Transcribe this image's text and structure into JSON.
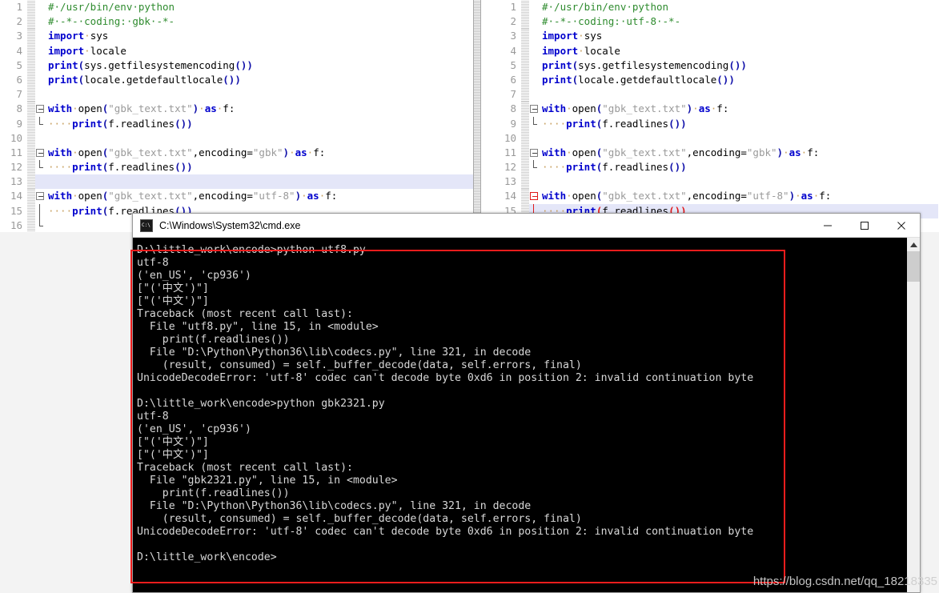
{
  "editor": {
    "left_pane": {
      "name": "gbk-source-editor",
      "lines": [
        {
          "no": "1",
          "tokens": [
            {
              "t": "comment",
              "v": "#·/usr/bin/env·python"
            }
          ]
        },
        {
          "no": "2",
          "tokens": [
            {
              "t": "comment",
              "v": "#·-*-·coding:·gbk·-*-"
            }
          ]
        },
        {
          "no": "3",
          "tokens": [
            {
              "t": "kw",
              "v": "import"
            },
            {
              "t": "ws",
              "v": "·"
            },
            {
              "t": "plain",
              "v": "sys"
            }
          ]
        },
        {
          "no": "4",
          "tokens": [
            {
              "t": "kw",
              "v": "import"
            },
            {
              "t": "ws",
              "v": "·"
            },
            {
              "t": "plain",
              "v": "locale"
            }
          ]
        },
        {
          "no": "5",
          "tokens": [
            {
              "t": "fn",
              "v": "print"
            },
            {
              "t": "paren",
              "v": "("
            },
            {
              "t": "plain",
              "v": "sys.getfilesystemencoding"
            },
            {
              "t": "paren",
              "v": "())"
            }
          ]
        },
        {
          "no": "6",
          "tokens": [
            {
              "t": "fn",
              "v": "print"
            },
            {
              "t": "paren",
              "v": "("
            },
            {
              "t": "plain",
              "v": "locale.getdefaultlocale"
            },
            {
              "t": "paren",
              "v": "())"
            }
          ]
        },
        {
          "no": "7",
          "tokens": []
        },
        {
          "no": "8",
          "fold": "open",
          "tokens": [
            {
              "t": "kw",
              "v": "with"
            },
            {
              "t": "ws",
              "v": "·"
            },
            {
              "t": "plain",
              "v": "open"
            },
            {
              "t": "paren",
              "v": "("
            },
            {
              "t": "str",
              "v": "\"gbk_text.txt\""
            },
            {
              "t": "paren",
              "v": ")"
            },
            {
              "t": "ws",
              "v": "·"
            },
            {
              "t": "kw",
              "v": "as"
            },
            {
              "t": "ws",
              "v": "·"
            },
            {
              "t": "plain",
              "v": "f:"
            }
          ]
        },
        {
          "no": "9",
          "fold": "end",
          "tokens": [
            {
              "t": "ws",
              "v": "····"
            },
            {
              "t": "fn",
              "v": "print"
            },
            {
              "t": "paren",
              "v": "("
            },
            {
              "t": "plain",
              "v": "f.readlines"
            },
            {
              "t": "paren",
              "v": "())"
            }
          ]
        },
        {
          "no": "10",
          "tokens": []
        },
        {
          "no": "11",
          "fold": "open",
          "tokens": [
            {
              "t": "kw",
              "v": "with"
            },
            {
              "t": "ws",
              "v": "·"
            },
            {
              "t": "plain",
              "v": "open"
            },
            {
              "t": "paren",
              "v": "("
            },
            {
              "t": "str",
              "v": "\"gbk_text.txt\""
            },
            {
              "t": "punct",
              "v": ","
            },
            {
              "t": "plain",
              "v": "encoding="
            },
            {
              "t": "str",
              "v": "\"gbk\""
            },
            {
              "t": "paren",
              "v": ")"
            },
            {
              "t": "ws",
              "v": "·"
            },
            {
              "t": "kw",
              "v": "as"
            },
            {
              "t": "ws",
              "v": "·"
            },
            {
              "t": "plain",
              "v": "f:"
            }
          ]
        },
        {
          "no": "12",
          "fold": "end",
          "tokens": [
            {
              "t": "ws",
              "v": "····"
            },
            {
              "t": "fn",
              "v": "print"
            },
            {
              "t": "paren",
              "v": "("
            },
            {
              "t": "plain",
              "v": "f.readlines"
            },
            {
              "t": "paren",
              "v": "())"
            }
          ]
        },
        {
          "no": "13",
          "highlight": true,
          "tokens": []
        },
        {
          "no": "14",
          "fold": "open",
          "tokens": [
            {
              "t": "kw",
              "v": "with"
            },
            {
              "t": "ws",
              "v": "·"
            },
            {
              "t": "plain",
              "v": "open"
            },
            {
              "t": "paren",
              "v": "("
            },
            {
              "t": "str",
              "v": "\"gbk_text.txt\""
            },
            {
              "t": "punct",
              "v": ","
            },
            {
              "t": "plain",
              "v": "encoding="
            },
            {
              "t": "str",
              "v": "\"utf-8\""
            },
            {
              "t": "paren",
              "v": ")"
            },
            {
              "t": "ws",
              "v": "·"
            },
            {
              "t": "kw",
              "v": "as"
            },
            {
              "t": "ws",
              "v": "·"
            },
            {
              "t": "plain",
              "v": "f:"
            }
          ]
        },
        {
          "no": "15",
          "fold": "bar",
          "tokens": [
            {
              "t": "ws",
              "v": "····"
            },
            {
              "t": "fn",
              "v": "print"
            },
            {
              "t": "paren",
              "v": "("
            },
            {
              "t": "plain",
              "v": "f.readlines"
            },
            {
              "t": "paren",
              "v": "())"
            }
          ]
        },
        {
          "no": "16",
          "fold": "end",
          "tokens": []
        }
      ]
    },
    "right_pane": {
      "name": "utf8-source-editor",
      "lines": [
        {
          "no": "1",
          "tokens": [
            {
              "t": "comment",
              "v": "#·/usr/bin/env·python"
            }
          ]
        },
        {
          "no": "2",
          "tokens": [
            {
              "t": "comment",
              "v": "#·-*-·coding:·utf-8·-*-"
            }
          ]
        },
        {
          "no": "3",
          "tokens": [
            {
              "t": "kw",
              "v": "import"
            },
            {
              "t": "ws",
              "v": "·"
            },
            {
              "t": "plain",
              "v": "sys"
            }
          ]
        },
        {
          "no": "4",
          "tokens": [
            {
              "t": "kw",
              "v": "import"
            },
            {
              "t": "ws",
              "v": "·"
            },
            {
              "t": "plain",
              "v": "locale"
            }
          ]
        },
        {
          "no": "5",
          "tokens": [
            {
              "t": "fn",
              "v": "print"
            },
            {
              "t": "paren",
              "v": "("
            },
            {
              "t": "plain",
              "v": "sys.getfilesystemencoding"
            },
            {
              "t": "paren",
              "v": "())"
            }
          ]
        },
        {
          "no": "6",
          "tokens": [
            {
              "t": "fn",
              "v": "print"
            },
            {
              "t": "paren",
              "v": "("
            },
            {
              "t": "plain",
              "v": "locale.getdefaultlocale"
            },
            {
              "t": "paren",
              "v": "())"
            }
          ]
        },
        {
          "no": "7",
          "tokens": []
        },
        {
          "no": "8",
          "fold": "open",
          "tokens": [
            {
              "t": "kw",
              "v": "with"
            },
            {
              "t": "ws",
              "v": "·"
            },
            {
              "t": "plain",
              "v": "open"
            },
            {
              "t": "paren",
              "v": "("
            },
            {
              "t": "str",
              "v": "\"gbk_text.txt\""
            },
            {
              "t": "paren",
              "v": ")"
            },
            {
              "t": "ws",
              "v": "·"
            },
            {
              "t": "kw",
              "v": "as"
            },
            {
              "t": "ws",
              "v": "·"
            },
            {
              "t": "plain",
              "v": "f:"
            }
          ]
        },
        {
          "no": "9",
          "fold": "end",
          "tokens": [
            {
              "t": "ws",
              "v": "····"
            },
            {
              "t": "fn",
              "v": "print"
            },
            {
              "t": "paren",
              "v": "("
            },
            {
              "t": "plain",
              "v": "f.readlines"
            },
            {
              "t": "paren",
              "v": "())"
            }
          ]
        },
        {
          "no": "10",
          "tokens": []
        },
        {
          "no": "11",
          "fold": "open",
          "tokens": [
            {
              "t": "kw",
              "v": "with"
            },
            {
              "t": "ws",
              "v": "·"
            },
            {
              "t": "plain",
              "v": "open"
            },
            {
              "t": "paren",
              "v": "("
            },
            {
              "t": "str",
              "v": "\"gbk_text.txt\""
            },
            {
              "t": "punct",
              "v": ","
            },
            {
              "t": "plain",
              "v": "encoding="
            },
            {
              "t": "str",
              "v": "\"gbk\""
            },
            {
              "t": "paren",
              "v": ")"
            },
            {
              "t": "ws",
              "v": "·"
            },
            {
              "t": "kw",
              "v": "as"
            },
            {
              "t": "ws",
              "v": "·"
            },
            {
              "t": "plain",
              "v": "f:"
            }
          ]
        },
        {
          "no": "12",
          "fold": "end",
          "tokens": [
            {
              "t": "ws",
              "v": "····"
            },
            {
              "t": "fn",
              "v": "print"
            },
            {
              "t": "paren",
              "v": "("
            },
            {
              "t": "plain",
              "v": "f.readlines"
            },
            {
              "t": "paren",
              "v": "())"
            }
          ]
        },
        {
          "no": "13",
          "tokens": []
        },
        {
          "no": "14",
          "fold": "open-red",
          "tokens": [
            {
              "t": "kw",
              "v": "with"
            },
            {
              "t": "ws",
              "v": "·"
            },
            {
              "t": "plain",
              "v": "open"
            },
            {
              "t": "paren",
              "v": "("
            },
            {
              "t": "str",
              "v": "\"gbk_text.txt\""
            },
            {
              "t": "punct",
              "v": ","
            },
            {
              "t": "plain",
              "v": "encoding="
            },
            {
              "t": "str",
              "v": "\"utf-8\""
            },
            {
              "t": "paren",
              "v": ")"
            },
            {
              "t": "ws",
              "v": "·"
            },
            {
              "t": "kw",
              "v": "as"
            },
            {
              "t": "ws",
              "v": "·"
            },
            {
              "t": "plain",
              "v": "f:"
            }
          ]
        },
        {
          "no": "15",
          "fold": "bar-red",
          "highlight": true,
          "tokens": [
            {
              "t": "ws",
              "v": "····"
            },
            {
              "t": "fn",
              "v": "print"
            },
            {
              "t": "paren-r",
              "v": "("
            },
            {
              "t": "plain",
              "v": "f.readlines"
            },
            {
              "t": "paren-r",
              "v": "())"
            }
          ]
        }
      ]
    }
  },
  "cmd_window": {
    "title": "C:\\Windows\\System32\\cmd.exe",
    "icon": "cmd-icon",
    "buttons": {
      "minimize": "minimize-button",
      "maximize": "maximize-button",
      "close": "close-button"
    },
    "console_output": "D:\\little_work\\encode>python utf8.py\nutf-8\n('en_US', 'cp936')\n[\"('中文')\"]\n[\"('中文')\"]\nTraceback (most recent call last):\n  File \"utf8.py\", line 15, in <module>\n    print(f.readlines())\n  File \"D:\\Python\\Python36\\lib\\codecs.py\", line 321, in decode\n    (result, consumed) = self._buffer_decode(data, self.errors, final)\nUnicodeDecodeError: 'utf-8' codec can't decode byte 0xd6 in position 2: invalid continuation byte\n\nD:\\little_work\\encode>python gbk2321.py\nutf-8\n('en_US', 'cp936')\n[\"('中文')\"]\n[\"('中文')\"]\nTraceback (most recent call last):\n  File \"gbk2321.py\", line 15, in <module>\n    print(f.readlines())\n  File \"D:\\Python\\Python36\\lib\\codecs.py\", line 321, in decode\n    (result, consumed) = self._buffer_decode(data, self.errors, final)\nUnicodeDecodeError: 'utf-8' codec can't decode byte 0xd6 in position 2: invalid continuation byte\n\nD:\\little_work\\encode>",
    "scrollbar": {
      "up_arrow": "scroll-up-arrow"
    }
  },
  "annotation": {
    "highlight_color": "#ee1c1c"
  },
  "watermark": {
    "text": "https://blog.csdn.net/qq_18218335"
  }
}
